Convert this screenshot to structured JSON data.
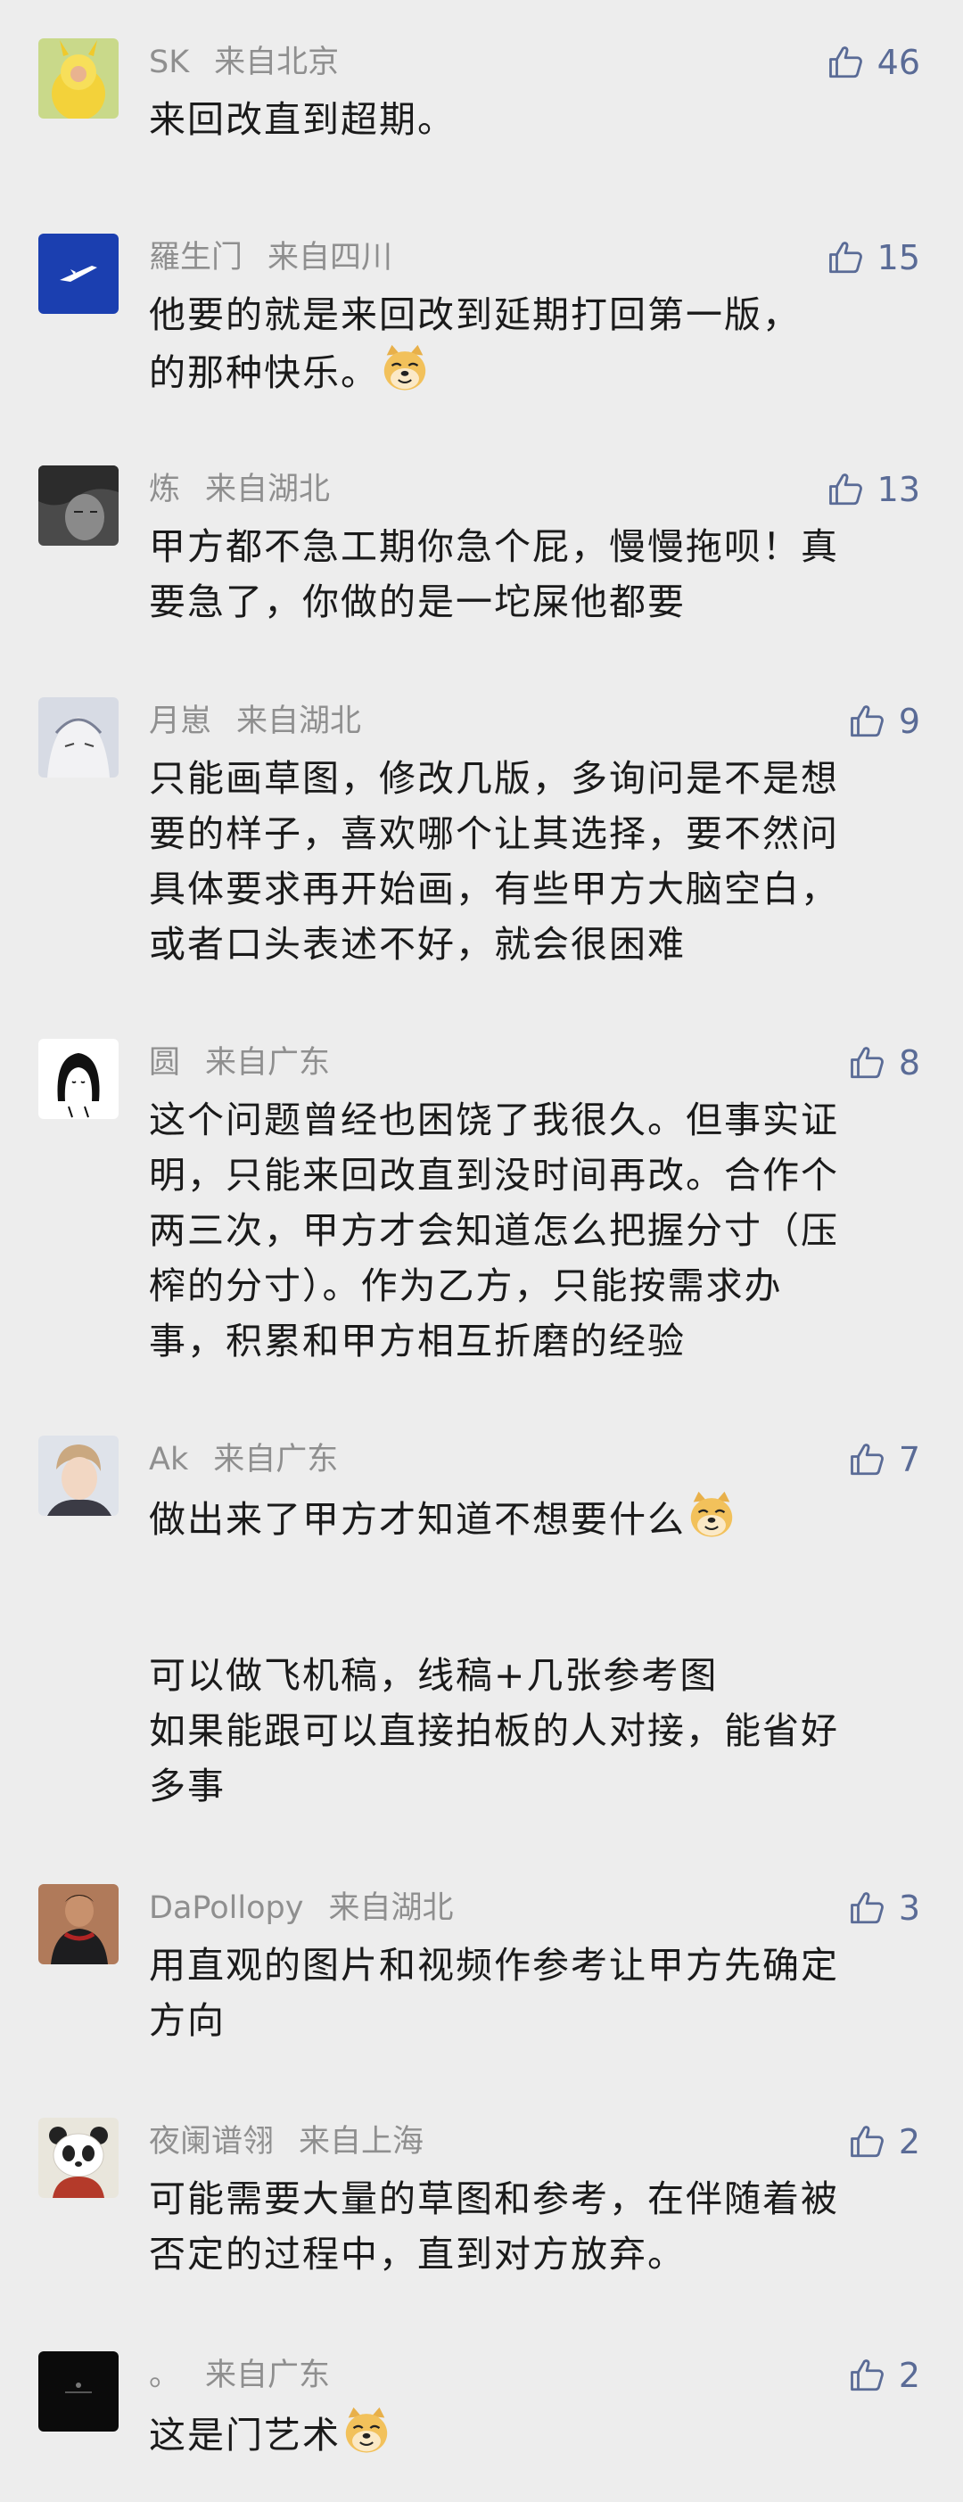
{
  "comments": [
    {
      "name": "SK",
      "location": "来自北京",
      "likes": "46",
      "text": "来回改直到超期。",
      "emoji": false
    },
    {
      "name": "羅生门",
      "location": "来自四川",
      "likes": "15",
      "text": "他要的就是来回改到延期打回第一版，\n的那种快乐。",
      "emoji": true
    },
    {
      "name": "炼",
      "location": "来自湖北",
      "likes": "13",
      "text": "甲方都不急工期你急个屁，慢慢拖呗！真\n要急了，你做的是一坨屎他都要",
      "emoji": false
    },
    {
      "name": "月崽",
      "location": "来自湖北",
      "likes": "9",
      "text": "只能画草图，修改几版，多询问是不是想\n要的样子，喜欢哪个让其选择，要不然问\n具体要求再开始画，有些甲方大脑空白，\n或者口头表述不好，就会很困难",
      "emoji": false
    },
    {
      "name": "圆",
      "location": "来自广东",
      "likes": "8",
      "text": "这个问题曾经也困饶了我很久。但事实证\n明，只能来回改直到没时间再改。合作个\n两三次，甲方才会知道怎么把握分寸（压\n榨的分寸）。作为乙方，只能按需求办\n事，积累和甲方相互折磨的经验",
      "emoji": false
    },
    {
      "name": "Ak",
      "location": "来自广东",
      "likes": "7",
      "text": "做出来了甲方才知道不想要什么",
      "emoji": true,
      "extra": "可以做飞机稿，线稿+几张参考图\n如果能跟可以直接拍板的人对接，能省好\n多事"
    },
    {
      "name": "DaPollopy",
      "location": "来自湖北",
      "likes": "3",
      "text": "用直观的图片和视频作参考让甲方先确定\n方向",
      "emoji": false
    },
    {
      "name": "夜阑谱翎",
      "location": "来自上海",
      "likes": "2",
      "text": "可能需要大量的草图和参考，在伴随着被\n否定的过程中，直到对方放弃。",
      "emoji": false
    },
    {
      "name": "。",
      "location": "来自广东",
      "likes": "2",
      "text": "这是门艺术",
      "emoji": true
    }
  ],
  "colors": {
    "background": "#ededed",
    "meta_text": "#8f8f8f",
    "like_accent": "#5a6b96",
    "body_text": "#1a1a1a"
  },
  "icons": {
    "like": "thumbs-up-icon",
    "emoji": "doge-emoji-icon"
  }
}
